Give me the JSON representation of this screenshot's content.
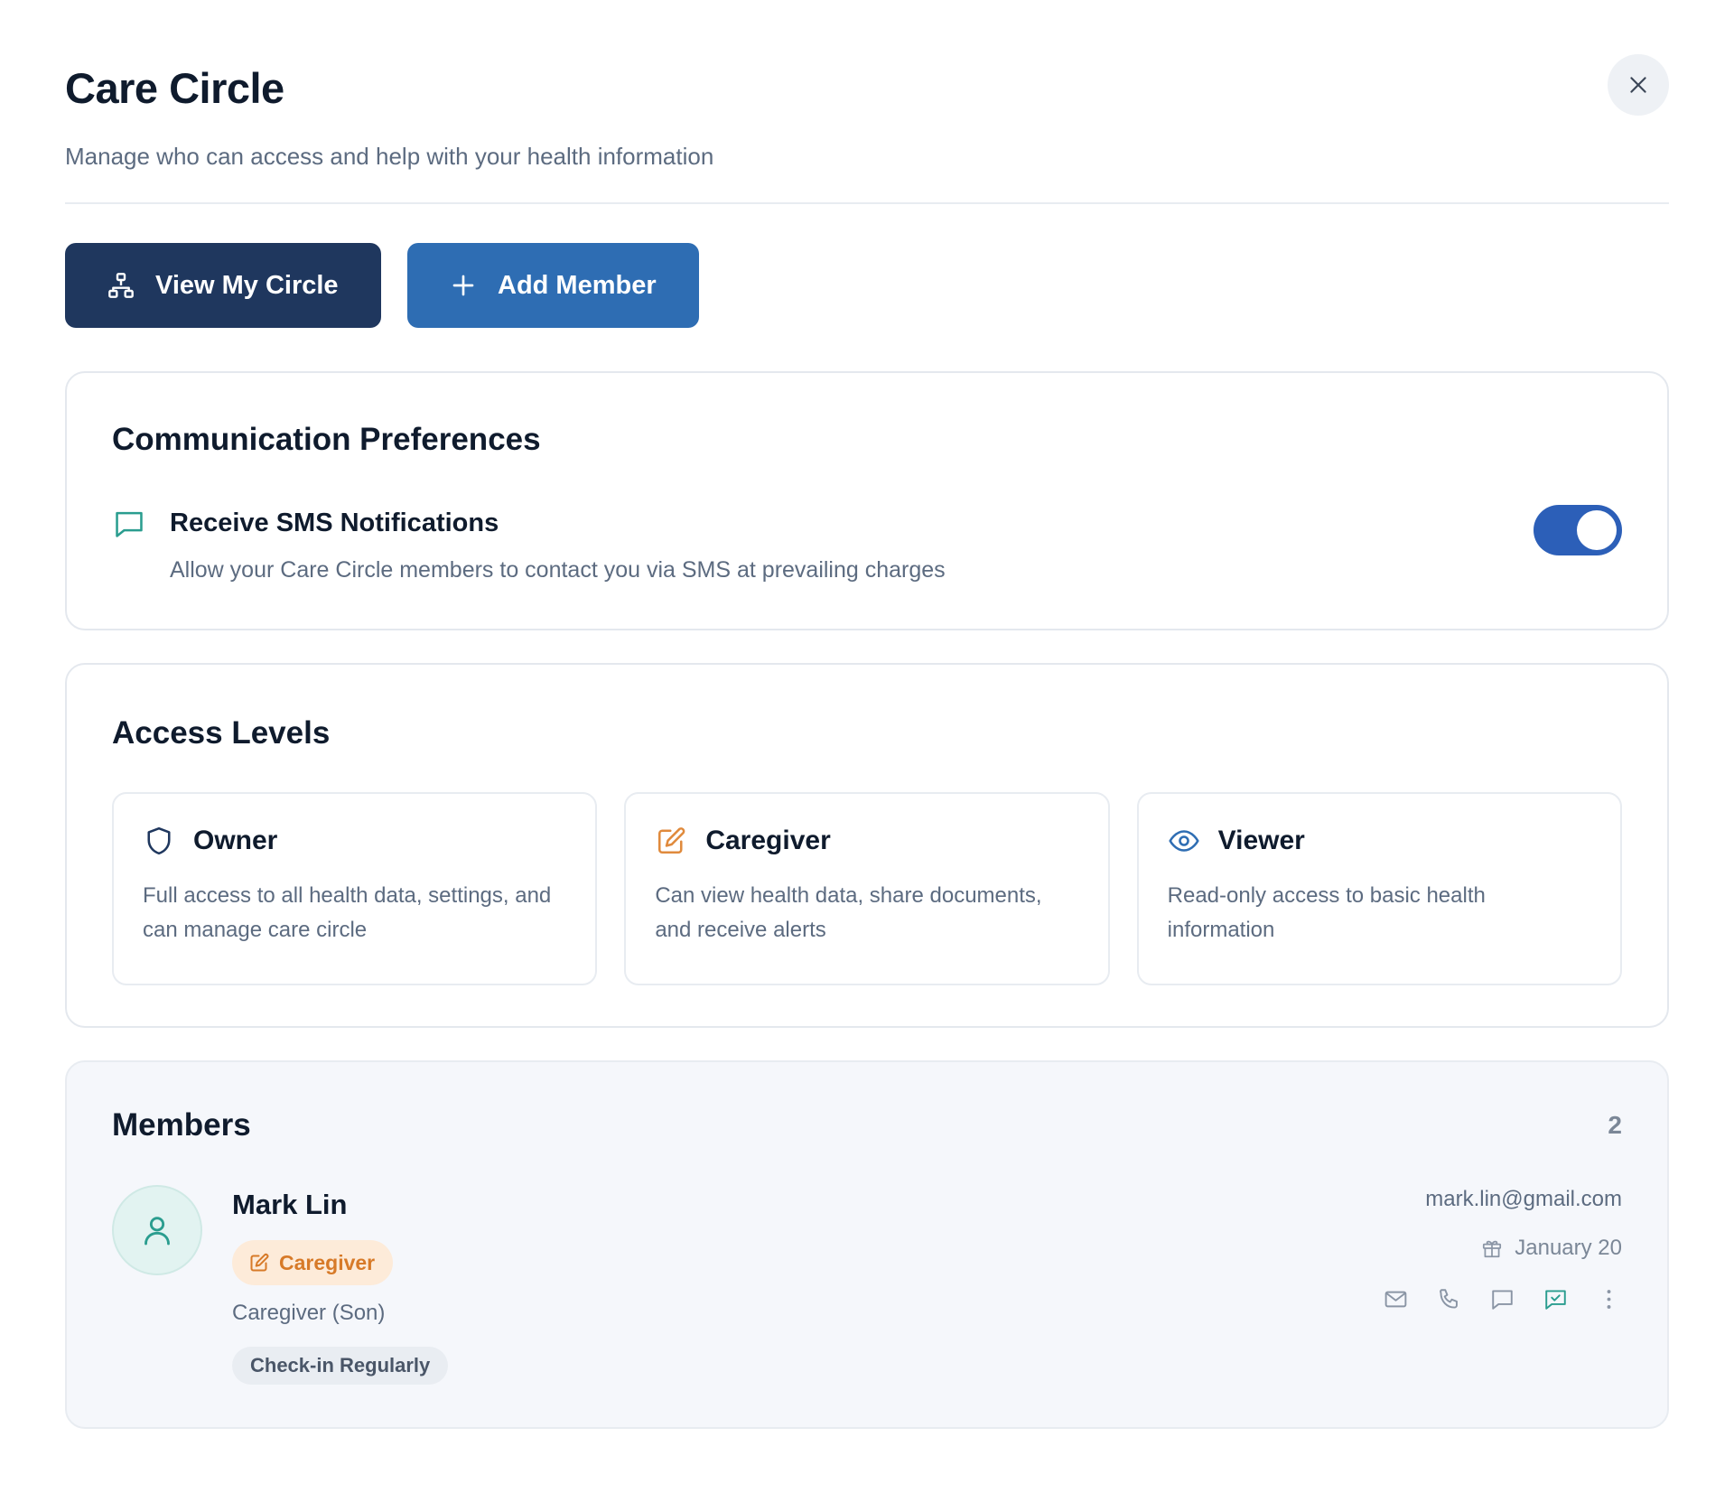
{
  "header": {
    "title": "Care Circle",
    "subtitle": "Manage who can access and help with your health information"
  },
  "actions": {
    "view_circle_label": "View My Circle",
    "add_member_label": "Add Member"
  },
  "communication": {
    "title": "Communication Preferences",
    "sms_title": "Receive SMS Notifications",
    "sms_description": "Allow your Care Circle members to contact you via SMS at prevailing charges",
    "sms_enabled": true
  },
  "access_levels": {
    "title": "Access Levels",
    "levels": [
      {
        "name": "Owner",
        "icon": "shield-icon",
        "description": "Full access to all health data, settings, and can manage care circle",
        "color": "#1f375e"
      },
      {
        "name": "Caregiver",
        "icon": "edit-icon",
        "description": "Can view health data, share documents, and receive alerts",
        "color": "#e08a3c"
      },
      {
        "name": "Viewer",
        "icon": "eye-icon",
        "description": "Read-only access to basic health information",
        "color": "#2e6db3"
      }
    ]
  },
  "members": {
    "title": "Members",
    "count": "2",
    "list": [
      {
        "name": "Mark Lin",
        "role": "Caregiver",
        "relation": "Caregiver (Son)",
        "preference": "Check-in Regularly",
        "email": "mark.lin@gmail.com",
        "birthday": "January 20"
      }
    ]
  },
  "colors": {
    "primary_dark": "#1f375e",
    "primary_blue": "#2e6db3",
    "toggle_on": "#2c5fb8",
    "teal_accent": "#2a9d8f",
    "caregiver_orange": "#d77a28"
  }
}
